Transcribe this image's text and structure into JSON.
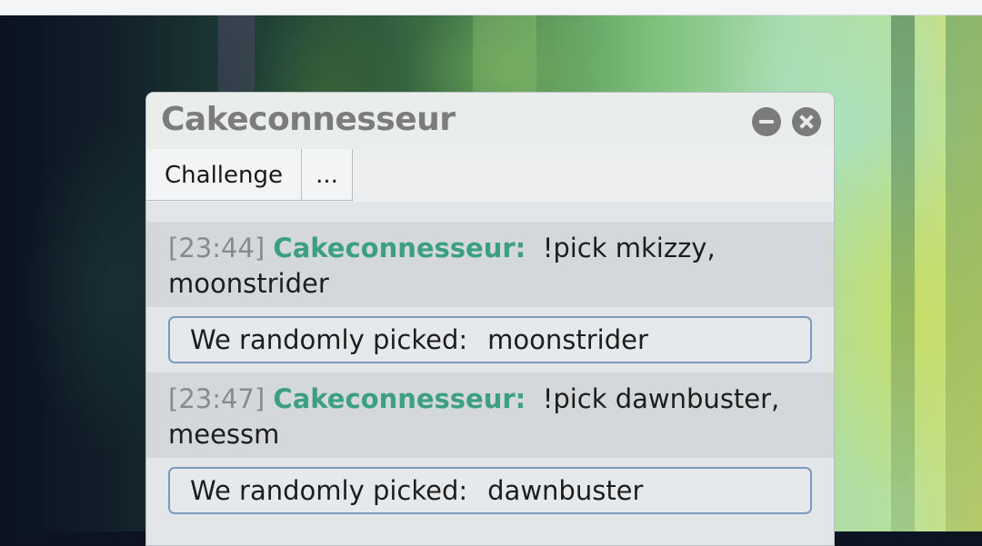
{
  "window": {
    "title": "Cakeconnesseur",
    "controls": {
      "minimize_icon": "minus-circle-icon",
      "close_icon": "close-circle-icon"
    }
  },
  "tabs": [
    {
      "label": "Challenge"
    },
    {
      "label": "..."
    }
  ],
  "messages": [
    {
      "time": "[23:44]",
      "user": "Cakeconnesseur:",
      "text": "!pick mkizzy,",
      "text_cont": "moonstrider",
      "result_label": "We randomly picked:",
      "result_value": "moonstrider"
    },
    {
      "time": "[23:47]",
      "user": "Cakeconnesseur:",
      "text": "!pick dawnbuster,",
      "text_cont": "meessm",
      "result_label": "We randomly picked:",
      "result_value": "dawnbuster"
    }
  ],
  "colors": {
    "username": "#3b9f82",
    "timestamp": "#8a8a8a",
    "result_border": "#7d98bc"
  }
}
